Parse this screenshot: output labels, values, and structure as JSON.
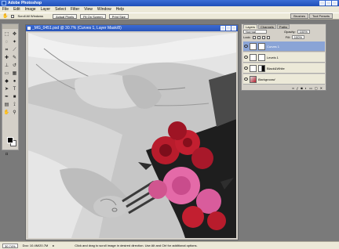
{
  "app": {
    "title": "Adobe Photoshop"
  },
  "menu": [
    "File",
    "Edit",
    "Image",
    "Layer",
    "Select",
    "Filter",
    "View",
    "Window",
    "Help"
  ],
  "options": {
    "scroll_all_label": "Scroll All Windows",
    "actual_pixels": "Actual Pixels",
    "fit_on_screen": "Fit On Screen",
    "print_size": "Print Size"
  },
  "palette_well": [
    "Brushes",
    "Tool Presets"
  ],
  "document": {
    "title": "_MG_0451.psd @ 30.7% (Curves 1, Layer Mask/8)"
  },
  "layers_panel": {
    "tabs": [
      "Layers",
      "Channels",
      "Paths"
    ],
    "blend_mode": "Normal",
    "opacity_label": "Opacity:",
    "opacity_value": "100%",
    "lock_label": "Lock:",
    "fill_label": "Fill:",
    "fill_value": "100%",
    "layers": [
      {
        "name": "Curves 1",
        "selected": true
      },
      {
        "name": "Levels 1",
        "selected": false
      },
      {
        "name": "Black&White",
        "selected": false
      },
      {
        "name": "Background",
        "selected": false
      }
    ]
  },
  "status": {
    "zoom": "30.74%",
    "doc": "Doc: 10.4M/20.7M",
    "hint": "Click and drag to scroll image in desired direction. Use Alt and Ctrl for additional options."
  },
  "colors": {
    "rose_red": "#b81c2c",
    "rose_pink": "#e46aa8",
    "selection_blue": "#8aa4d6"
  }
}
